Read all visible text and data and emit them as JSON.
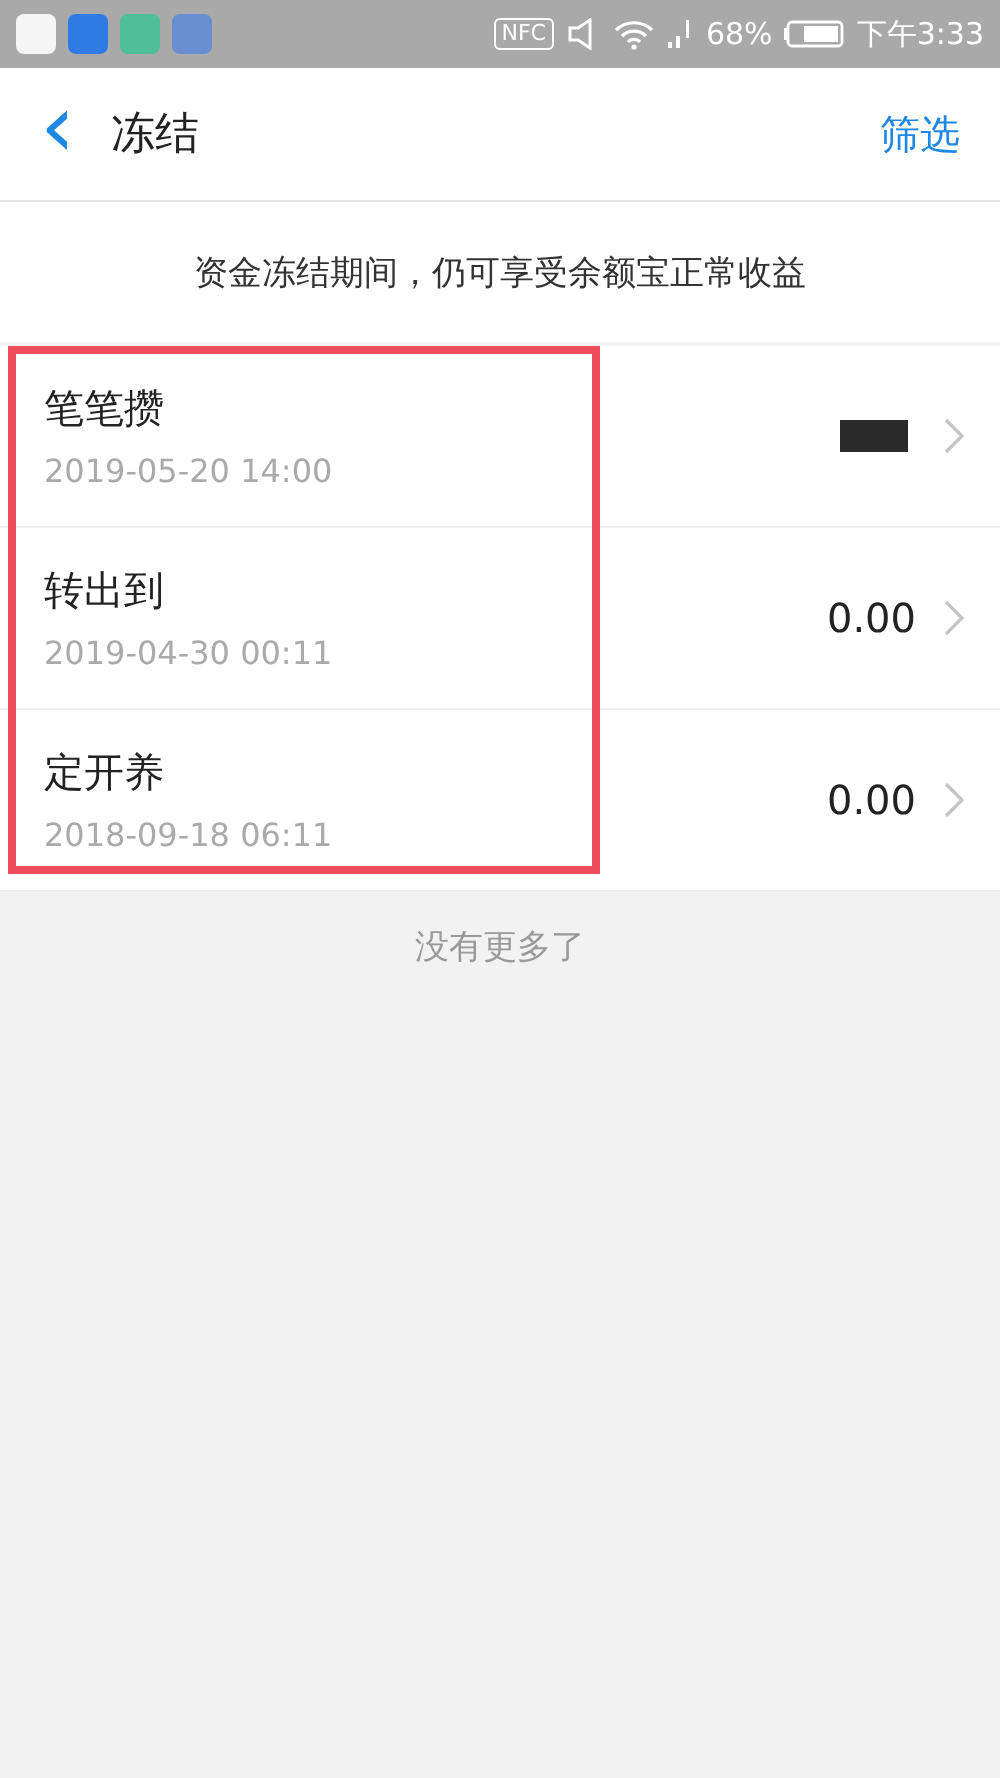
{
  "status_bar": {
    "nfc": "NFC",
    "battery": "68%",
    "time": "下午3:33"
  },
  "header": {
    "back": "‹",
    "title": "冻结",
    "action": "筛选"
  },
  "notice": "资金冻结期间，仍可享受余额宝正常收益",
  "records": [
    {
      "title": "笔笔攒",
      "time": "2019-05-20 14:00",
      "amount_redacted": true
    },
    {
      "title": "转出到",
      "time": "2019-04-30 00:11",
      "amount": "0.00",
      "amount_redacted": false
    },
    {
      "title": "定开养",
      "time": "2018-09-18 06:11",
      "amount": "0.00",
      "amount_redacted": false
    }
  ],
  "highlight": true,
  "footer": "没有更多了"
}
